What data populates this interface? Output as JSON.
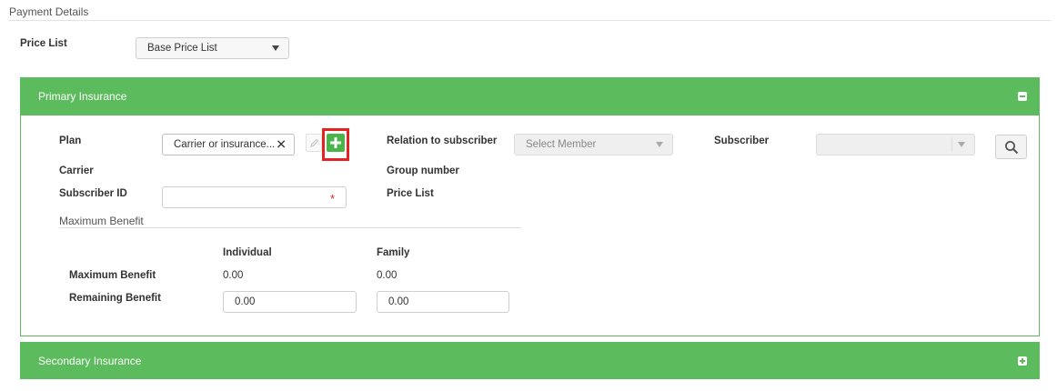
{
  "payment_details": {
    "title": "Payment Details",
    "price_list_label": "Price List",
    "price_list_value": "Base Price List"
  },
  "primary": {
    "header": "Primary Insurance",
    "plan_label": "Plan",
    "plan_value": "Carrier or insurance...",
    "relation_label": "Relation to subscriber",
    "relation_placeholder": "Select Member",
    "subscriber_label": "Subscriber",
    "subscriber_value": "",
    "carrier_label": "Carrier",
    "group_number_label": "Group number",
    "subscriber_id_label": "Subscriber ID",
    "subscriber_id_value": "",
    "required_mark": "*",
    "price_list_label": "Price List",
    "max_benefit_section": "Maximum Benefit",
    "col_individual": "Individual",
    "col_family": "Family",
    "row_max_benefit": "Maximum Benefit",
    "max_individual": "0.00",
    "max_family": "0.00",
    "row_remaining": "Remaining Benefit",
    "remaining_individual": "0.00",
    "remaining_family": "0.00"
  },
  "secondary": {
    "header": "Secondary Insurance"
  },
  "colors": {
    "panel_green": "#5cbb5c",
    "add_button_green": "#47b547",
    "highlight_red": "#e32222",
    "required_red": "#e02020"
  },
  "icons": {
    "plan_clear": "close-icon",
    "edit": "pencil-icon",
    "add": "plus-icon",
    "search": "magnifier-icon",
    "collapse": "minus-icon",
    "expand": "plus-icon"
  }
}
